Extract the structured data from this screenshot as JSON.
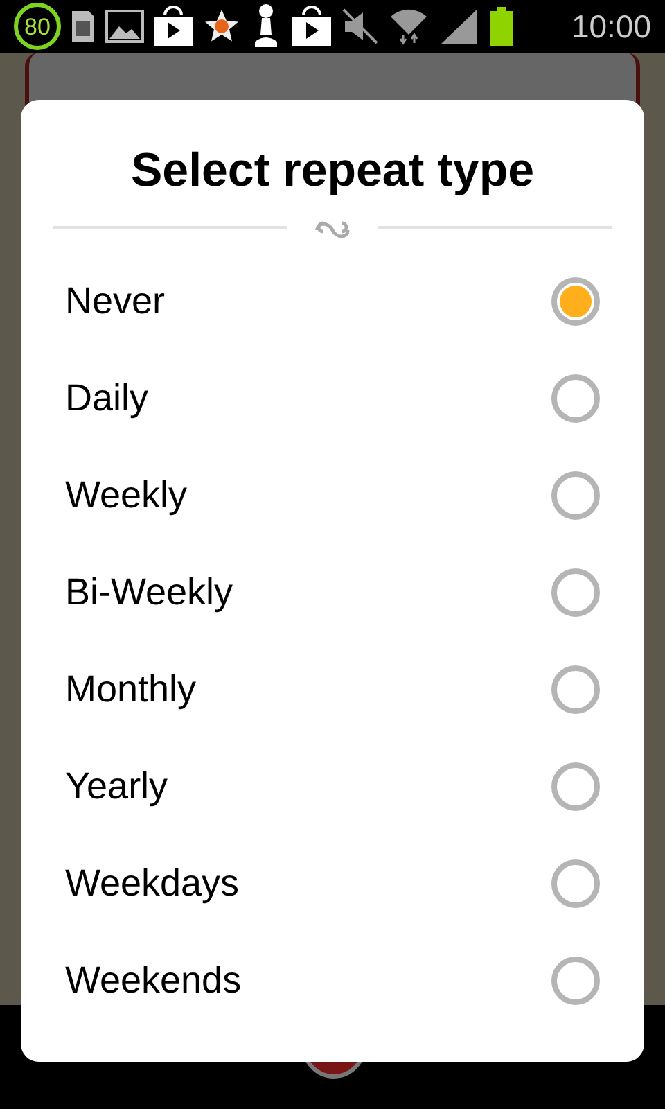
{
  "status_bar": {
    "badge": "80",
    "time": "10:00"
  },
  "dialog": {
    "title": "Select repeat type",
    "options": [
      {
        "label": "Never",
        "selected": true
      },
      {
        "label": "Daily",
        "selected": false
      },
      {
        "label": "Weekly",
        "selected": false
      },
      {
        "label": "Bi-Weekly",
        "selected": false
      },
      {
        "label": "Monthly",
        "selected": false
      },
      {
        "label": "Yearly",
        "selected": false
      },
      {
        "label": "Weekdays",
        "selected": false
      },
      {
        "label": "Weekends",
        "selected": false
      }
    ]
  }
}
